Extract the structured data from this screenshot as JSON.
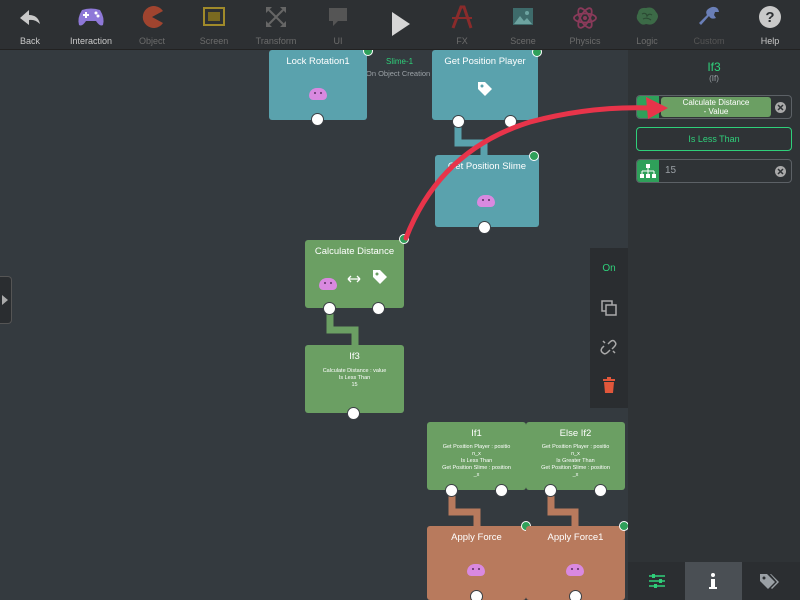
{
  "toolbar": {
    "items": [
      {
        "label": "Back",
        "icon": "back-arrow-icon"
      },
      {
        "label": "Interaction",
        "icon": "gamepad-icon"
      },
      {
        "label": "Object",
        "icon": "pacman-icon"
      },
      {
        "label": "Screen",
        "icon": "screen-icon"
      },
      {
        "label": "Transform",
        "icon": "transform-icon"
      },
      {
        "label": "UI",
        "icon": "speech-bubble-icon"
      },
      {
        "label": "",
        "icon": "play-icon"
      },
      {
        "label": "FX",
        "icon": "fx-icon"
      },
      {
        "label": "Scene",
        "icon": "image-icon"
      },
      {
        "label": "Physics",
        "icon": "atom-icon"
      },
      {
        "label": "Logic",
        "icon": "brain-icon"
      },
      {
        "label": "Custom",
        "icon": "wrench-icon"
      },
      {
        "label": "Help",
        "icon": "help-icon"
      }
    ]
  },
  "canvas": {
    "object_name": "Slime-1",
    "object_subtitle": "On Object Creation",
    "nodes": {
      "lock_rotation": {
        "title": "Lock Rotation1"
      },
      "get_pos_player": {
        "title": "Get Position Player"
      },
      "get_pos_slime": {
        "title": "Get Position Slime"
      },
      "calc_distance": {
        "title": "Calculate Distance"
      },
      "if3": {
        "title": "If3",
        "desc": [
          "Calculate Distance : value",
          "Is Less Than",
          "15"
        ]
      },
      "if1": {
        "title": "If1",
        "desc": [
          "Get Position Player : positio",
          "n_x",
          "Is Less Than",
          "Get Position Slime : position",
          "_x"
        ]
      },
      "else_if2": {
        "title": "Else If2",
        "desc": [
          "Get Position Player : positio",
          "n_x",
          "Is Greater Than",
          "Get Position Slime : position",
          "_x"
        ]
      },
      "apply_force": {
        "title": "Apply Force"
      },
      "apply_force1": {
        "title": "Apply Force1"
      }
    }
  },
  "floattools": {
    "on_label": "On"
  },
  "panel": {
    "title": "If3",
    "subtitle": "(If)",
    "value1_line1": "Calculate Distance",
    "value1_line2": "- Value",
    "operator": "Is Less Than",
    "value2": "15"
  },
  "colors": {
    "accent_green": "#2fd07a",
    "teal_node": "#5aa2ad",
    "green_node": "#6b9f63",
    "brown_node": "#b87a5d",
    "arrow_red": "#e8344a"
  }
}
